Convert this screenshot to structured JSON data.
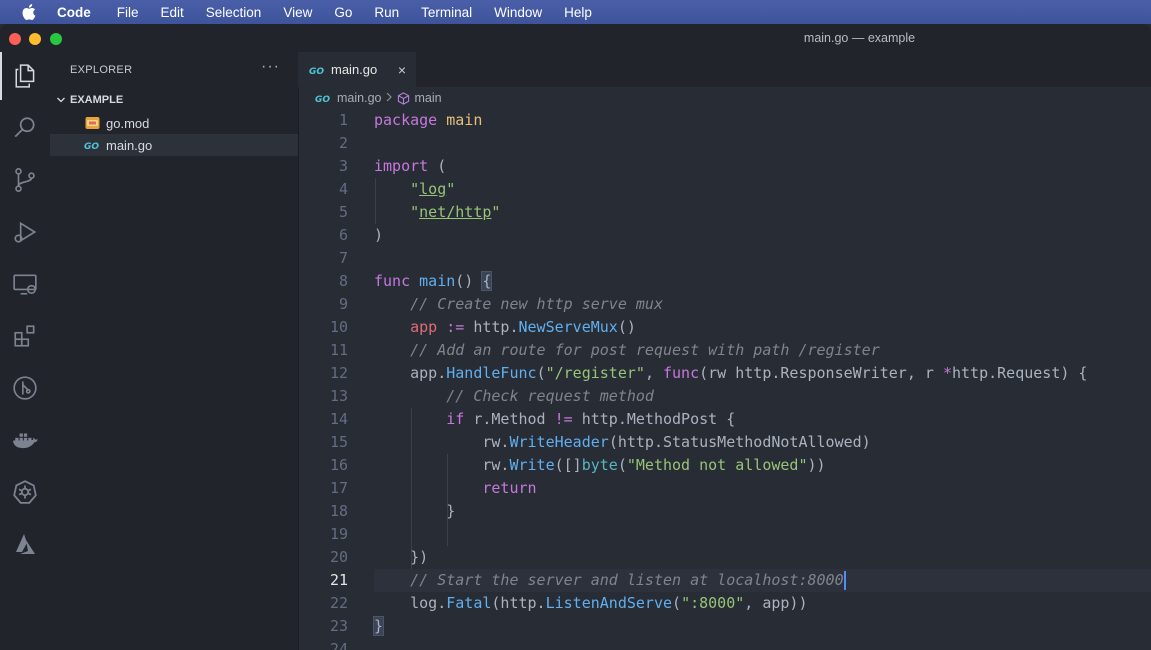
{
  "menubar": {
    "app": "Code",
    "items": [
      "File",
      "Edit",
      "Selection",
      "View",
      "Go",
      "Run",
      "Terminal",
      "Window",
      "Help"
    ]
  },
  "window": {
    "title": "main.go — example"
  },
  "activity_bar": [
    "explorer-icon",
    "search-icon",
    "source-control-icon",
    "run-debug-icon",
    "remote-explorer-icon",
    "extensions-icon",
    "git-graph-icon",
    "docker-icon",
    "kubernetes-icon",
    "azure-icon"
  ],
  "sidebar": {
    "title": "EXPLORER",
    "more": "···",
    "folder": "EXAMPLE",
    "files": [
      {
        "name": "go.mod",
        "icon": "go-mod-icon"
      },
      {
        "name": "main.go",
        "icon": "go-icon",
        "selected": true
      }
    ]
  },
  "editor": {
    "tab": {
      "label": "main.go",
      "close": "×"
    },
    "breadcrumb": {
      "file": "main.go",
      "symbol": "main"
    },
    "current_line": 21,
    "lines": [
      {
        "n": "1",
        "html": "<span class=\"k\">package</span> <span class=\"t\">main</span>"
      },
      {
        "n": "2",
        "html": ""
      },
      {
        "n": "3",
        "html": "<span class=\"k\">import</span> ("
      },
      {
        "n": "4",
        "html": "    <span class=\"s\">\"<span class=\"u\">log</span>\"</span>"
      },
      {
        "n": "5",
        "html": "    <span class=\"s\">\"<span class=\"u\">net/http</span>\"</span>"
      },
      {
        "n": "6",
        "html": ")"
      },
      {
        "n": "7",
        "html": ""
      },
      {
        "n": "8",
        "html": "<span class=\"k\">func</span> <span class=\"f\">main</span>() <span class=\"bm\">{</span>"
      },
      {
        "n": "9",
        "html": "    <span class=\"c\">// Create new http serve mux</span>"
      },
      {
        "n": "10",
        "html": "    <span class=\"v\">app</span> <span class=\"k\">:=</span> http.<span class=\"f\">NewServeMux</span>()"
      },
      {
        "n": "11",
        "html": "    <span class=\"c\">// Add an route for post request with path /register</span>"
      },
      {
        "n": "12",
        "html": "    app.<span class=\"f\">HandleFunc</span>(<span class=\"s\">\"/register\"</span>, <span class=\"k\">func</span>(rw http.ResponseWriter, r <span class=\"k\">*</span>http.Request) {"
      },
      {
        "n": "13",
        "html": "        <span class=\"c\">// Check request method</span>"
      },
      {
        "n": "14",
        "html": "        <span class=\"k\">if</span> r.Method <span class=\"k\">!=</span> http.MethodPost {"
      },
      {
        "n": "15",
        "html": "            rw.<span class=\"f\">WriteHeader</span>(http.StatusMethodNotAllowed)"
      },
      {
        "n": "16",
        "html": "            rw.<span class=\"f\">Write</span>([]<span class=\"o\">byte</span>(<span class=\"s\">\"Method not allowed\"</span>))"
      },
      {
        "n": "17",
        "html": "            <span class=\"k\">return</span>"
      },
      {
        "n": "18",
        "html": "        }"
      },
      {
        "n": "19",
        "html": ""
      },
      {
        "n": "20",
        "html": "    })"
      },
      {
        "n": "21",
        "html": "    <span class=\"c\">// Start the server and listen at localhost:8000</span><span class=\"caret\"></span>"
      },
      {
        "n": "22",
        "html": "    log.<span class=\"f\">Fatal</span>(http.<span class=\"f\">ListenAndServe</span>(<span class=\"s\">\":8000\"</span>, app))"
      },
      {
        "n": "23",
        "html": "<span class=\"bm\">}</span>"
      },
      {
        "n": "24",
        "html": ""
      }
    ]
  }
}
